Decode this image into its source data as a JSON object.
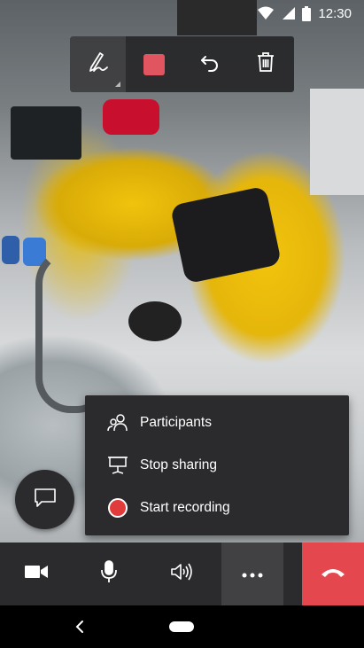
{
  "status_bar": {
    "time": "12:30"
  },
  "ink_toolbar": {
    "tools": [
      "pen-icon",
      "color-swatch",
      "undo-icon",
      "delete-icon"
    ],
    "active_tool": "pen",
    "pen_color": "#e0555f"
  },
  "overflow_menu": {
    "items": [
      {
        "label": "Participants",
        "icon": "participants-icon"
      },
      {
        "label": "Stop sharing",
        "icon": "stop-sharing-icon"
      },
      {
        "label": "Start recording",
        "icon": "record-icon"
      }
    ]
  },
  "call_bar": {
    "buttons": [
      "video-icon",
      "microphone-icon",
      "speaker-icon",
      "more-icon",
      "hang-up-icon"
    ],
    "hangup_color": "#e4474d"
  },
  "chat_button": {
    "icon": "chat-icon"
  }
}
